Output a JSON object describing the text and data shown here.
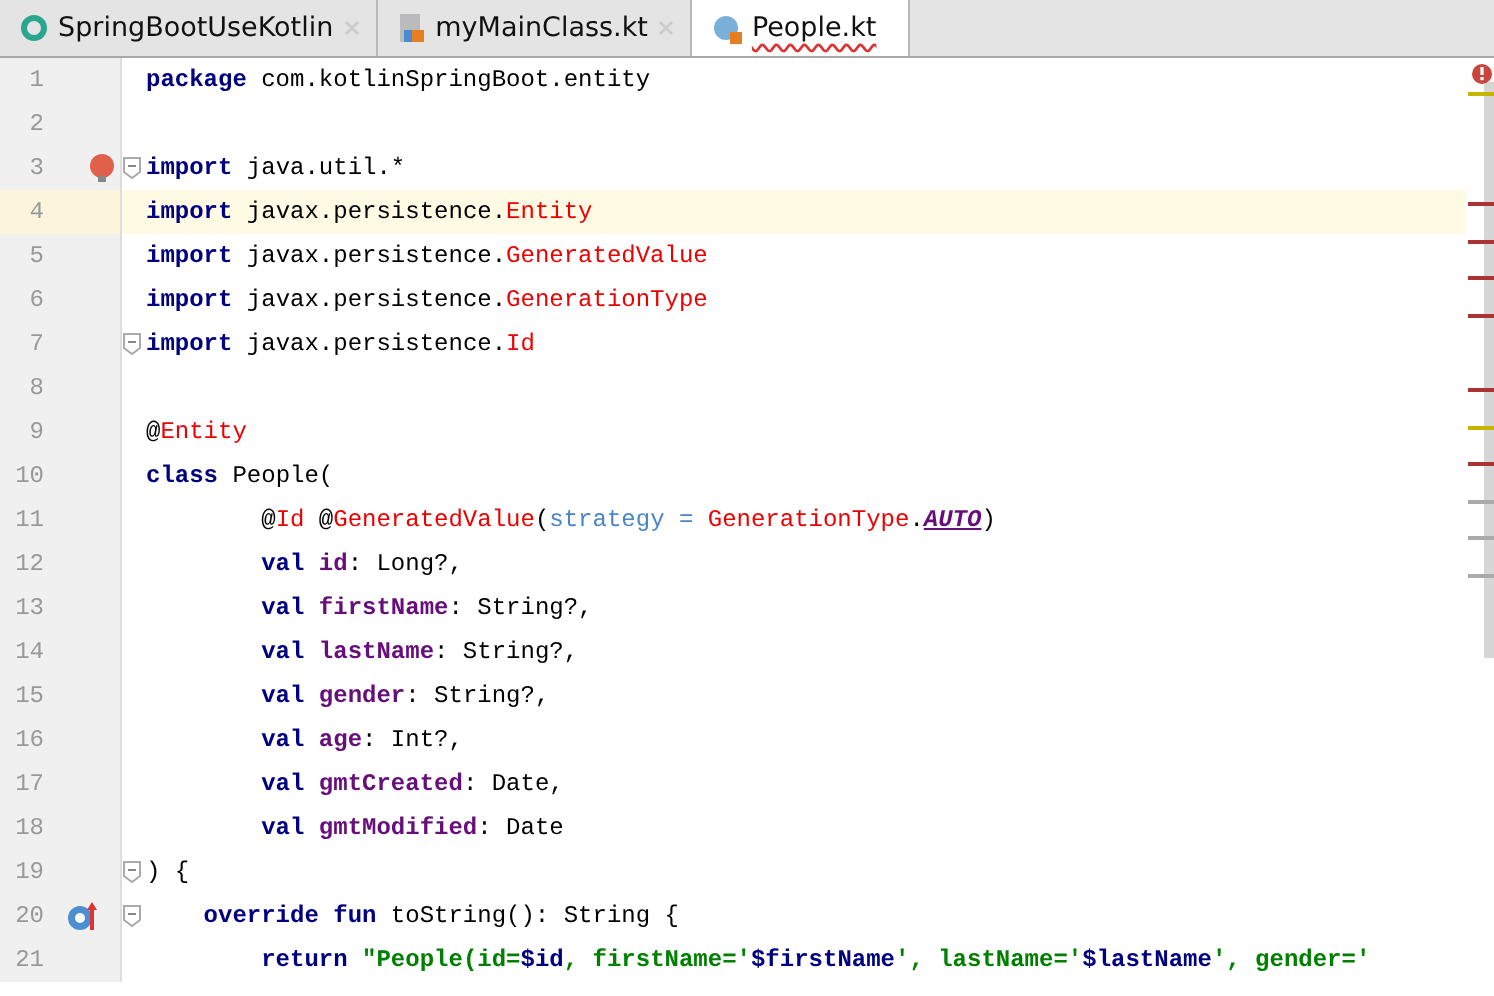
{
  "tabs": [
    {
      "label": "SpringBootUseKotlin",
      "kind": "project",
      "selected": false
    },
    {
      "label": "myMainClass.kt",
      "kind": "file",
      "selected": false
    },
    {
      "label": "People.kt",
      "kind": "class",
      "selected": true
    }
  ],
  "editor": {
    "lines": [
      {
        "number": "1",
        "current": false,
        "fold": false,
        "tokens": [
          {
            "t": "package ",
            "kind": "keyword"
          },
          {
            "t": "com.kotlinSpringBoot.entity",
            "kind": "plain"
          }
        ]
      },
      {
        "number": "2",
        "current": false,
        "fold": false
      },
      {
        "number": "3",
        "current": false,
        "fold": true,
        "kind": "bulb",
        "tokens": [
          {
            "t": "import ",
            "kind": "keyword"
          },
          {
            "t": "java.util.*",
            "kind": "plain"
          }
        ]
      },
      {
        "number": "4",
        "current": true,
        "fold": false,
        "tokens": [
          {
            "t": "import ",
            "kind": "keyword"
          },
          {
            "t": "javax.persistence.",
            "kind": "plain"
          },
          {
            "t": "Entity",
            "kind": "unresolved"
          }
        ]
      },
      {
        "number": "5",
        "current": false,
        "fold": false,
        "tokens": [
          {
            "t": "import ",
            "kind": "keyword"
          },
          {
            "t": "javax.persistence.",
            "kind": "plain"
          },
          {
            "t": "GeneratedValue",
            "kind": "unresolved"
          }
        ]
      },
      {
        "number": "6",
        "current": false,
        "fold": false,
        "tokens": [
          {
            "t": "import ",
            "kind": "keyword"
          },
          {
            "t": "javax.persistence.",
            "kind": "plain"
          },
          {
            "t": "GenerationType",
            "kind": "unresolved"
          }
        ]
      },
      {
        "number": "7",
        "current": false,
        "fold": true,
        "tokens": [
          {
            "t": "import ",
            "kind": "keyword"
          },
          {
            "t": "javax.persistence.",
            "kind": "plain"
          },
          {
            "t": "Id",
            "kind": "unresolved"
          }
        ]
      },
      {
        "number": "8",
        "current": false,
        "fold": false
      },
      {
        "number": "9",
        "current": false,
        "fold": false,
        "tokens": [
          {
            "t": "@",
            "kind": "plain"
          },
          {
            "t": "Entity",
            "kind": "unresolved"
          }
        ]
      },
      {
        "number": "10",
        "current": false,
        "fold": false,
        "tokens": [
          {
            "t": "class ",
            "kind": "keyword"
          },
          {
            "t": "People(",
            "kind": "plain"
          }
        ]
      },
      {
        "number": "11",
        "current": false,
        "fold": false,
        "tokens": [
          {
            "t": "        @",
            "kind": "plain"
          },
          {
            "t": "Id",
            "kind": "unresolved"
          },
          {
            "t": " @",
            "kind": "plain"
          },
          {
            "t": "GeneratedValue",
            "kind": "unresolved"
          },
          {
            "t": "(",
            "kind": "plain"
          },
          {
            "t": "strategy = ",
            "kind": "parameter"
          },
          {
            "t": "GenerationType",
            "kind": "unresolved"
          },
          {
            "t": ".",
            "kind": "plain"
          },
          {
            "t": "AUTO",
            "kind": "constant"
          },
          {
            "t": ")",
            "kind": "plain"
          }
        ]
      },
      {
        "number": "12",
        "current": false,
        "fold": false,
        "tokens": [
          {
            "t": "        val ",
            "kind": "keyword"
          },
          {
            "t": "id",
            "kind": "property"
          },
          {
            "t": ": Long?,",
            "kind": "plain"
          }
        ]
      },
      {
        "number": "13",
        "current": false,
        "fold": false,
        "tokens": [
          {
            "t": "        val ",
            "kind": "keyword"
          },
          {
            "t": "firstName",
            "kind": "property"
          },
          {
            "t": ": String?,",
            "kind": "plain"
          }
        ]
      },
      {
        "number": "14",
        "current": false,
        "fold": false,
        "tokens": [
          {
            "t": "        val ",
            "kind": "keyword"
          },
          {
            "t": "lastName",
            "kind": "property"
          },
          {
            "t": ": String?,",
            "kind": "plain"
          }
        ]
      },
      {
        "number": "15",
        "current": false,
        "fold": false,
        "tokens": [
          {
            "t": "        val ",
            "kind": "keyword"
          },
          {
            "t": "gender",
            "kind": "property"
          },
          {
            "t": ": String?,",
            "kind": "plain"
          }
        ]
      },
      {
        "number": "16",
        "current": false,
        "fold": false,
        "tokens": [
          {
            "t": "        val ",
            "kind": "keyword"
          },
          {
            "t": "age",
            "kind": "property"
          },
          {
            "t": ": Int?,",
            "kind": "plain"
          }
        ]
      },
      {
        "number": "17",
        "current": false,
        "fold": false,
        "tokens": [
          {
            "t": "        val ",
            "kind": "keyword"
          },
          {
            "t": "gmtCreated",
            "kind": "property"
          },
          {
            "t": ": Date,",
            "kind": "plain"
          }
        ]
      },
      {
        "number": "18",
        "current": false,
        "fold": false,
        "tokens": [
          {
            "t": "        val ",
            "kind": "keyword"
          },
          {
            "t": "gmtModified",
            "kind": "property"
          },
          {
            "t": ": Date",
            "kind": "plain"
          }
        ]
      },
      {
        "number": "19",
        "current": false,
        "fold": true,
        "tokens": [
          {
            "t": ") {",
            "kind": "plain"
          }
        ]
      },
      {
        "number": "20",
        "current": false,
        "fold": true,
        "kind": "override",
        "tokens": [
          {
            "t": "    override fun ",
            "kind": "keyword"
          },
          {
            "t": "toString(): String {",
            "kind": "plain"
          }
        ]
      },
      {
        "number": "21",
        "current": false,
        "fold": false,
        "tokens": [
          {
            "t": "        return ",
            "kind": "keyword"
          },
          {
            "t": "\"People(id=",
            "kind": "string"
          },
          {
            "t": "$id",
            "kind": "template"
          },
          {
            "t": ", firstName='",
            "kind": "string"
          },
          {
            "t": "$firstName",
            "kind": "template"
          },
          {
            "t": "', lastName='",
            "kind": "string"
          },
          {
            "t": "$lastName",
            "kind": "template"
          },
          {
            "t": "', gender='",
            "kind": "string"
          }
        ]
      }
    ]
  }
}
